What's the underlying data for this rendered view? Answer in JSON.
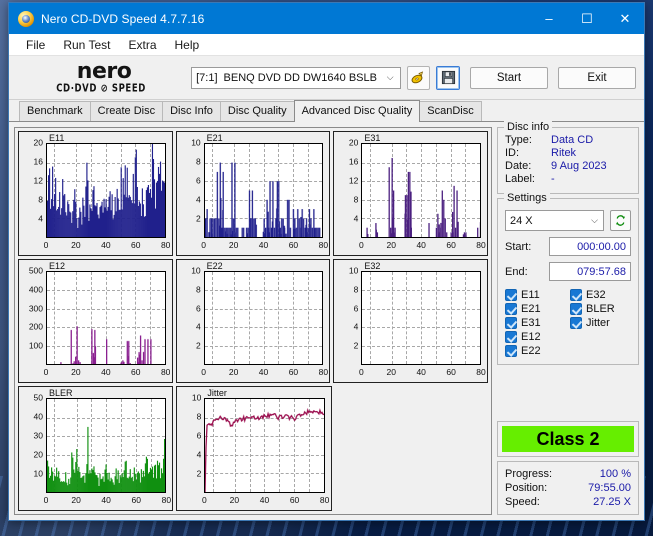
{
  "window": {
    "title": "Nero CD-DVD Speed 4.7.7.16",
    "icon": "nero-disc-icon",
    "controls": {
      "minimize": "–",
      "maximize": "☐",
      "close": "✕"
    }
  },
  "menubar": {
    "items": [
      "File",
      "Run Test",
      "Extra",
      "Help"
    ]
  },
  "toolbar": {
    "logo_word": "nero",
    "logo_sub": "CD·DVD ⊘ SPEED",
    "drive": {
      "index": "[7:1]",
      "name": "BENQ DVD DD DW1640 BSLB",
      "chevron": "⌵"
    },
    "eject_icon": "disc-speed-icon",
    "save_icon": "floppy-save-icon",
    "start_label": "Start",
    "exit_label": "Exit"
  },
  "tabs": [
    {
      "label": "Benchmark",
      "active": false
    },
    {
      "label": "Create Disc",
      "active": false
    },
    {
      "label": "Disc Info",
      "active": false
    },
    {
      "label": "Disc Quality",
      "active": false
    },
    {
      "label": "Advanced Disc Quality",
      "active": true
    },
    {
      "label": "ScanDisc",
      "active": false
    }
  ],
  "disc_info": {
    "legend": "Disc info",
    "rows": [
      {
        "key": "Type:",
        "value": "Data CD"
      },
      {
        "key": "ID:",
        "value": "Ritek"
      },
      {
        "key": "Date:",
        "value": "9 Aug 2023"
      },
      {
        "key": "Label:",
        "value": "-"
      }
    ]
  },
  "settings": {
    "legend": "Settings",
    "speed": "24 X",
    "speed_chevron": "⌵",
    "refresh_icon": "refresh-arrows-icon",
    "start_label": "Start:",
    "start_value": "000:00.00",
    "end_label": "End:",
    "end_value": "079:57.68",
    "checkboxes": [
      {
        "label": "E11",
        "checked": true
      },
      {
        "label": "E32",
        "checked": true
      },
      {
        "label": "E21",
        "checked": true
      },
      {
        "label": "BLER",
        "checked": true
      },
      {
        "label": "E31",
        "checked": true
      },
      {
        "label": "Jitter",
        "checked": true
      },
      {
        "label": "E12",
        "checked": true
      },
      {
        "label": "",
        "checked": false
      },
      {
        "label": "E22",
        "checked": true
      },
      {
        "label": "",
        "checked": false
      }
    ]
  },
  "class_badge": {
    "label": "Class 2",
    "color": "#66ee00"
  },
  "status": {
    "rows": [
      {
        "key": "Progress:",
        "value": "100 %"
      },
      {
        "key": "Position:",
        "value": "79:55.00"
      },
      {
        "key": "Speed:",
        "value": "27.25 X"
      }
    ]
  },
  "chart_data": [
    {
      "id": "E11",
      "type": "area",
      "title": "E11",
      "color": "#20208c",
      "xlabel": "",
      "ylabel": "",
      "xlim": [
        0,
        80
      ],
      "ylim": [
        0,
        20
      ],
      "xticks": [
        0,
        20,
        40,
        60,
        80
      ],
      "yticks": [
        4,
        8,
        12,
        16,
        20
      ],
      "grid": true,
      "x": [
        0,
        1,
        2,
        3,
        4,
        5,
        6,
        7,
        8,
        9,
        10,
        11,
        12,
        13,
        14,
        15,
        16,
        17,
        18,
        19,
        20,
        21,
        22,
        23,
        24,
        25,
        26,
        27,
        28,
        29,
        30,
        31,
        32,
        33,
        34,
        35,
        36,
        37,
        38,
        39,
        40,
        41,
        42,
        43,
        44,
        45,
        46,
        47,
        48,
        49,
        50,
        51,
        52,
        53,
        54,
        55,
        56,
        57,
        58,
        59,
        60,
        61,
        62,
        63,
        64,
        65,
        66,
        67,
        68,
        69,
        70,
        71,
        72,
        73,
        74,
        75,
        76,
        77,
        78,
        79,
        80
      ],
      "values": [
        7,
        12,
        8,
        9,
        7,
        10,
        8,
        7,
        9,
        8,
        11,
        7,
        6,
        5,
        7,
        6,
        5,
        4,
        6,
        5,
        4,
        3,
        5,
        4,
        6,
        5,
        7,
        20,
        6,
        5,
        7,
        9,
        6,
        7,
        5,
        6,
        7,
        5,
        6,
        5,
        7,
        6,
        8,
        6,
        7,
        6,
        8,
        7,
        9,
        8,
        12,
        9,
        13,
        10,
        9,
        8,
        10,
        9,
        11,
        10,
        15,
        9,
        8,
        9,
        7,
        8,
        6,
        7,
        9,
        8,
        11,
        10,
        12,
        9,
        11,
        10,
        12,
        11,
        17,
        13,
        15
      ]
    },
    {
      "id": "E21",
      "type": "bar",
      "title": "E21",
      "color": "#20208c",
      "xlim": [
        0,
        80
      ],
      "ylim": [
        0,
        10
      ],
      "xticks": [
        0,
        20,
        40,
        60,
        80
      ],
      "yticks": [
        2,
        4,
        6,
        8,
        10
      ],
      "grid": true,
      "x": [
        0,
        1,
        2,
        3,
        4,
        5,
        6,
        7,
        8,
        9,
        10,
        11,
        12,
        13,
        14,
        15,
        16,
        17,
        18,
        19,
        20,
        21,
        22,
        23,
        24,
        25,
        26,
        27,
        28,
        29,
        30,
        31,
        32,
        33,
        34,
        35,
        36,
        37,
        38,
        39,
        40,
        41,
        42,
        43,
        44,
        45,
        46,
        47,
        48,
        49,
        50,
        51,
        52,
        53,
        54,
        55,
        56,
        57,
        58,
        59,
        60,
        61,
        62,
        63,
        64,
        65,
        66,
        67,
        68,
        69,
        70,
        71,
        72,
        73,
        74,
        75,
        76,
        77,
        78,
        79,
        80
      ],
      "values": [
        2,
        3,
        0,
        2,
        2,
        2,
        2,
        2,
        7,
        2,
        8,
        1,
        7,
        1,
        1,
        1,
        1,
        1,
        8,
        2,
        8,
        1,
        1,
        0,
        0,
        1,
        1,
        0,
        1,
        1,
        5,
        2,
        5,
        2,
        2,
        0,
        0,
        0,
        0,
        0,
        2,
        1,
        4,
        1,
        6,
        1,
        6,
        1,
        2,
        6,
        6,
        1,
        2,
        2,
        1,
        0,
        4,
        4,
        1,
        0,
        3,
        2,
        1,
        3,
        2,
        1,
        3,
        2,
        1,
        2,
        1,
        3,
        2,
        1,
        3,
        1,
        1,
        1,
        1,
        0,
        0
      ]
    },
    {
      "id": "E31",
      "type": "bar",
      "title": "E31",
      "color": "#4b2080",
      "xlim": [
        0,
        80
      ],
      "ylim": [
        0,
        20
      ],
      "xticks": [
        0,
        20,
        40,
        60,
        80
      ],
      "yticks": [
        4,
        8,
        12,
        16,
        20
      ],
      "grid": true,
      "x": [
        0,
        1,
        2,
        3,
        4,
        5,
        6,
        7,
        8,
        9,
        10,
        11,
        12,
        13,
        14,
        15,
        16,
        17,
        18,
        19,
        20,
        21,
        22,
        23,
        24,
        25,
        26,
        27,
        28,
        29,
        30,
        31,
        32,
        33,
        34,
        35,
        36,
        37,
        38,
        39,
        40,
        41,
        42,
        43,
        44,
        45,
        46,
        47,
        48,
        49,
        50,
        51,
        52,
        53,
        54,
        55,
        56,
        57,
        58,
        59,
        60,
        61,
        62,
        63,
        64,
        65,
        66,
        67,
        68,
        69,
        70,
        71,
        72,
        73,
        74,
        75,
        76,
        77,
        78,
        79,
        80
      ],
      "values": [
        0,
        0,
        0,
        2,
        0,
        0,
        0,
        0,
        0,
        3,
        1,
        0,
        0,
        0,
        0,
        0,
        0,
        0,
        15,
        2,
        17,
        10,
        2,
        0,
        0,
        0,
        0,
        0,
        0,
        9,
        9,
        14,
        14,
        2,
        0,
        0,
        0,
        0,
        0,
        0,
        0,
        0,
        0,
        0,
        0,
        3,
        0,
        0,
        0,
        0,
        2,
        5,
        1,
        2,
        10,
        8,
        4,
        1,
        0,
        0,
        1,
        1,
        11,
        2,
        10,
        0,
        0,
        0,
        0,
        1,
        1,
        0,
        0,
        0,
        0,
        0,
        0,
        0,
        2,
        0,
        12
      ]
    },
    {
      "id": "E12",
      "type": "bar",
      "title": "E12",
      "color": "#8a2090",
      "xlim": [
        0,
        80
      ],
      "ylim": [
        0,
        500
      ],
      "xticks": [
        0,
        20,
        40,
        60,
        80
      ],
      "yticks": [
        100,
        200,
        300,
        400,
        500
      ],
      "grid": true,
      "x": [
        0,
        1,
        2,
        3,
        4,
        5,
        6,
        7,
        8,
        9,
        10,
        11,
        12,
        13,
        14,
        15,
        16,
        17,
        18,
        19,
        20,
        21,
        22,
        23,
        24,
        25,
        26,
        27,
        28,
        29,
        30,
        31,
        32,
        33,
        34,
        35,
        36,
        37,
        38,
        39,
        40,
        41,
        42,
        43,
        44,
        45,
        46,
        47,
        48,
        49,
        50,
        51,
        52,
        53,
        54,
        55,
        56,
        57,
        58,
        59,
        60,
        61,
        62,
        63,
        64,
        65,
        66,
        67,
        68,
        69,
        70,
        71,
        72,
        73,
        74,
        75,
        76,
        77,
        78,
        79,
        80
      ],
      "values": [
        0,
        0,
        0,
        0,
        0,
        0,
        0,
        0,
        0,
        10,
        0,
        0,
        0,
        0,
        0,
        0,
        185,
        0,
        15,
        40,
        205,
        20,
        10,
        0,
        0,
        0,
        0,
        0,
        0,
        0,
        190,
        60,
        185,
        0,
        0,
        0,
        0,
        0,
        0,
        0,
        135,
        0,
        0,
        0,
        0,
        0,
        0,
        0,
        0,
        0,
        10,
        20,
        0,
        0,
        125,
        125,
        5,
        0,
        0,
        0,
        0,
        35,
        65,
        155,
        20,
        0,
        135,
        0,
        135,
        0,
        135,
        0,
        0,
        0,
        0,
        0,
        0,
        0,
        0,
        0,
        130
      ]
    },
    {
      "id": "E22",
      "type": "bar",
      "title": "E22",
      "color": "#20208c",
      "xlim": [
        0,
        80
      ],
      "ylim": [
        0,
        10
      ],
      "xticks": [
        0,
        20,
        40,
        60,
        80
      ],
      "yticks": [
        2,
        4,
        6,
        8,
        10
      ],
      "grid": true,
      "x": [],
      "values": []
    },
    {
      "id": "E32",
      "type": "bar",
      "title": "E32",
      "color": "#4b2080",
      "xlim": [
        0,
        80
      ],
      "ylim": [
        0,
        10
      ],
      "xticks": [
        0,
        20,
        40,
        60,
        80
      ],
      "yticks": [
        2,
        4,
        6,
        8,
        10
      ],
      "grid": true,
      "x": [],
      "values": []
    },
    {
      "id": "BLER",
      "type": "area",
      "title": "BLER",
      "color": "#109010",
      "xlim": [
        0,
        80
      ],
      "ylim": [
        0,
        50
      ],
      "xticks": [
        0,
        20,
        40,
        60,
        80
      ],
      "yticks": [
        10,
        20,
        30,
        40,
        50
      ],
      "grid": true,
      "x": [
        0,
        1,
        2,
        3,
        4,
        5,
        6,
        7,
        8,
        9,
        10,
        11,
        12,
        13,
        14,
        15,
        16,
        17,
        18,
        19,
        20,
        21,
        22,
        23,
        24,
        25,
        26,
        27,
        28,
        29,
        30,
        31,
        32,
        33,
        34,
        35,
        36,
        37,
        38,
        39,
        40,
        41,
        42,
        43,
        44,
        45,
        46,
        47,
        48,
        49,
        50,
        51,
        52,
        53,
        54,
        55,
        56,
        57,
        58,
        59,
        60,
        61,
        62,
        63,
        64,
        65,
        66,
        67,
        68,
        69,
        70,
        71,
        72,
        73,
        74,
        75,
        76,
        77,
        78,
        79,
        80
      ],
      "values": [
        9,
        12,
        10,
        9,
        11,
        9,
        10,
        9,
        8,
        10,
        7,
        6,
        8,
        7,
        6,
        5,
        7,
        21,
        8,
        9,
        24,
        10,
        9,
        7,
        6,
        7,
        8,
        23,
        9,
        8,
        10,
        18,
        8,
        7,
        6,
        5,
        7,
        6,
        8,
        7,
        22,
        8,
        7,
        6,
        7,
        6,
        8,
        7,
        9,
        8,
        10,
        9,
        11,
        18,
        9,
        8,
        10,
        9,
        8,
        10,
        9,
        8,
        10,
        9,
        11,
        10,
        12,
        11,
        13,
        12,
        11,
        13,
        12,
        11,
        13,
        12,
        14,
        13,
        16,
        14,
        15
      ]
    },
    {
      "id": "Jitter",
      "type": "line",
      "title": "Jitter",
      "color": "#9c1050",
      "xlim": [
        0,
        80
      ],
      "ylim": [
        0,
        10
      ],
      "xticks": [
        0,
        20,
        40,
        60,
        80
      ],
      "yticks": [
        2,
        4,
        6,
        8,
        10
      ],
      "grid": true,
      "x": [
        0,
        1,
        2,
        3,
        4,
        5,
        6,
        7,
        8,
        9,
        10,
        11,
        12,
        13,
        14,
        15,
        16,
        17,
        18,
        19,
        20,
        21,
        22,
        23,
        24,
        25,
        26,
        27,
        28,
        29,
        30,
        31,
        32,
        33,
        34,
        35,
        36,
        37,
        38,
        39,
        40,
        41,
        42,
        43,
        44,
        45,
        46,
        47,
        48,
        49,
        50,
        51,
        52,
        53,
        54,
        55,
        56,
        57,
        58,
        59,
        60,
        61,
        62,
        63,
        64,
        65,
        66,
        67,
        68,
        69,
        70,
        71,
        72,
        73,
        74,
        75,
        76,
        77,
        78,
        79,
        80
      ],
      "values": [
        0,
        7.0,
        7.2,
        7.1,
        7.4,
        7.3,
        7.6,
        7.9,
        7.7,
        7.9,
        8.0,
        7.9,
        7.8,
        7.9,
        7.8,
        7.6,
        7.5,
        7.3,
        7.2,
        7.3,
        7.6,
        7.7,
        7.6,
        7.8,
        7.9,
        7.8,
        7.9,
        7.8,
        7.9,
        7.9,
        7.8,
        7.9,
        7.9,
        8.0,
        7.9,
        8.0,
        7.9,
        8.0,
        8.1,
        8.0,
        8.2,
        8.1,
        8.3,
        8.2,
        8.4,
        8.2,
        8.3,
        8.2,
        8.1,
        8.0,
        8.1,
        8.2,
        8.1,
        8.0,
        8.1,
        8.2,
        8.1,
        8.0,
        8.2,
        8.1,
        7.9,
        8.0,
        8.2,
        8.3,
        8.2,
        8.4,
        8.3,
        8.5,
        8.4,
        8.6,
        8.5,
        8.7,
        8.6,
        8.5,
        8.8,
        8.6,
        8.5,
        8.7,
        8.6,
        8.4,
        8.2
      ]
    }
  ]
}
